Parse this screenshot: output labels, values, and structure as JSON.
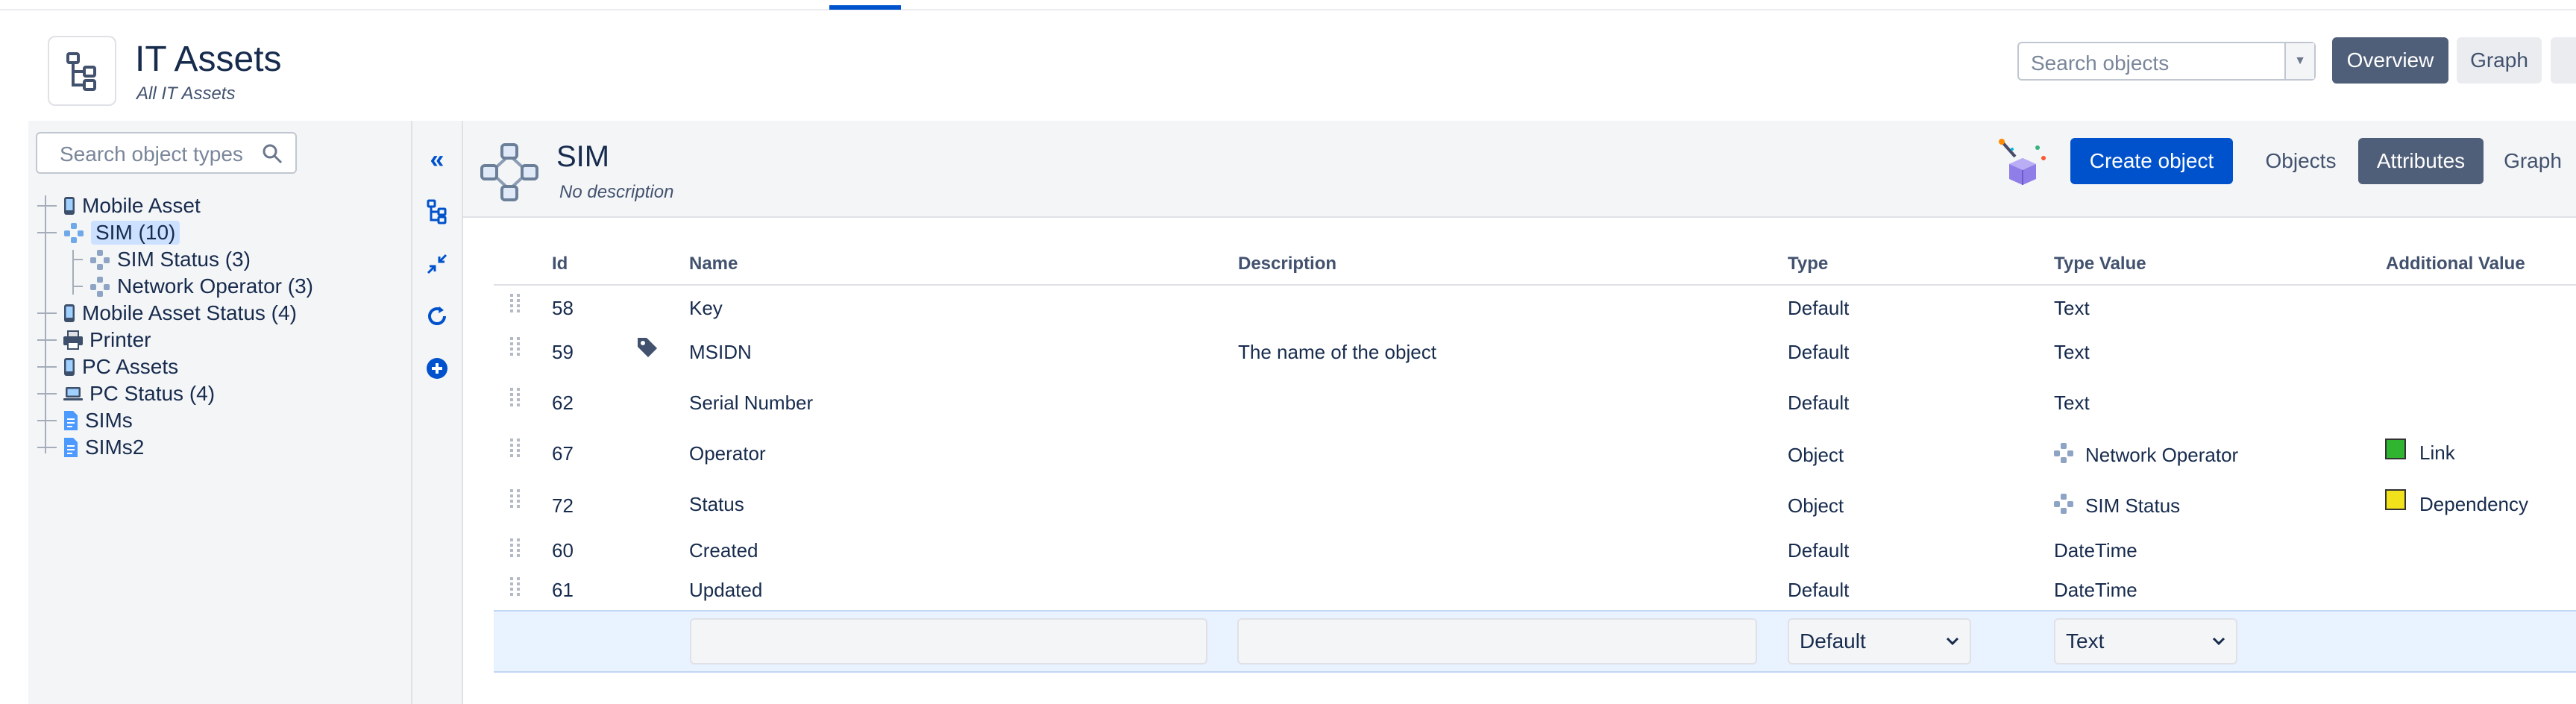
{
  "header": {
    "title": "IT Assets",
    "subtitle": "All IT Assets",
    "search_placeholder": "Search objects",
    "overview_label": "Overview",
    "graph_label": "Graph"
  },
  "sidebar": {
    "search_placeholder": "Search object types",
    "items": [
      {
        "label": "Mobile Asset",
        "icon": "phone-icon"
      },
      {
        "label": "SIM (10)",
        "icon": "network-icon",
        "selected": true
      },
      {
        "label": "SIM Status (3)",
        "icon": "network-icon"
      },
      {
        "label": "Network Operator (3)",
        "icon": "network-icon"
      },
      {
        "label": "Mobile Asset Status (4)",
        "icon": "phone-icon"
      },
      {
        "label": "Printer",
        "icon": "printer-icon"
      },
      {
        "label": "PC Assets",
        "icon": "phone-icon"
      },
      {
        "label": "PC Status (4)",
        "icon": "laptop-icon"
      },
      {
        "label": "SIMs",
        "icon": "document-icon"
      },
      {
        "label": "SIMs2",
        "icon": "document-icon"
      }
    ]
  },
  "content": {
    "title": "SIM",
    "description": "No description",
    "create_label": "Create object",
    "objects_label": "Objects",
    "attributes_label": "Attributes",
    "graph_label": "Graph"
  },
  "table": {
    "columns": [
      "Id",
      "Name",
      "Description",
      "Type",
      "Type Value",
      "Additional Value"
    ],
    "rows": [
      {
        "id": "58",
        "name": "Key",
        "description": "",
        "type": "Default",
        "type_value": "Text",
        "additional": ""
      },
      {
        "id": "59",
        "name": "MSIDN",
        "description": "The name of the object",
        "type": "Default",
        "type_value": "Text",
        "additional": "",
        "label_icon": true
      },
      {
        "id": "62",
        "name": "Serial Number",
        "description": "",
        "type": "Default",
        "type_value": "Text",
        "additional": ""
      },
      {
        "id": "67",
        "name": "Operator",
        "description": "",
        "type": "Object",
        "type_value": "Network Operator",
        "additional": "Link",
        "additional_color": "#2fb52f"
      },
      {
        "id": "72",
        "name": "Status",
        "description": "",
        "type": "Object",
        "type_value": "SIM Status",
        "additional": "Dependency",
        "additional_color": "#f2e21c"
      },
      {
        "id": "60",
        "name": "Created",
        "description": "",
        "type": "Default",
        "type_value": "DateTime",
        "additional": ""
      },
      {
        "id": "61",
        "name": "Updated",
        "description": "",
        "type": "Default",
        "type_value": "DateTime",
        "additional": ""
      }
    ],
    "new_row": {
      "type_select": "Default",
      "type_value_select": "Text"
    }
  },
  "colors": {
    "accent": "#0052cc",
    "selected_button": "#505f79"
  }
}
